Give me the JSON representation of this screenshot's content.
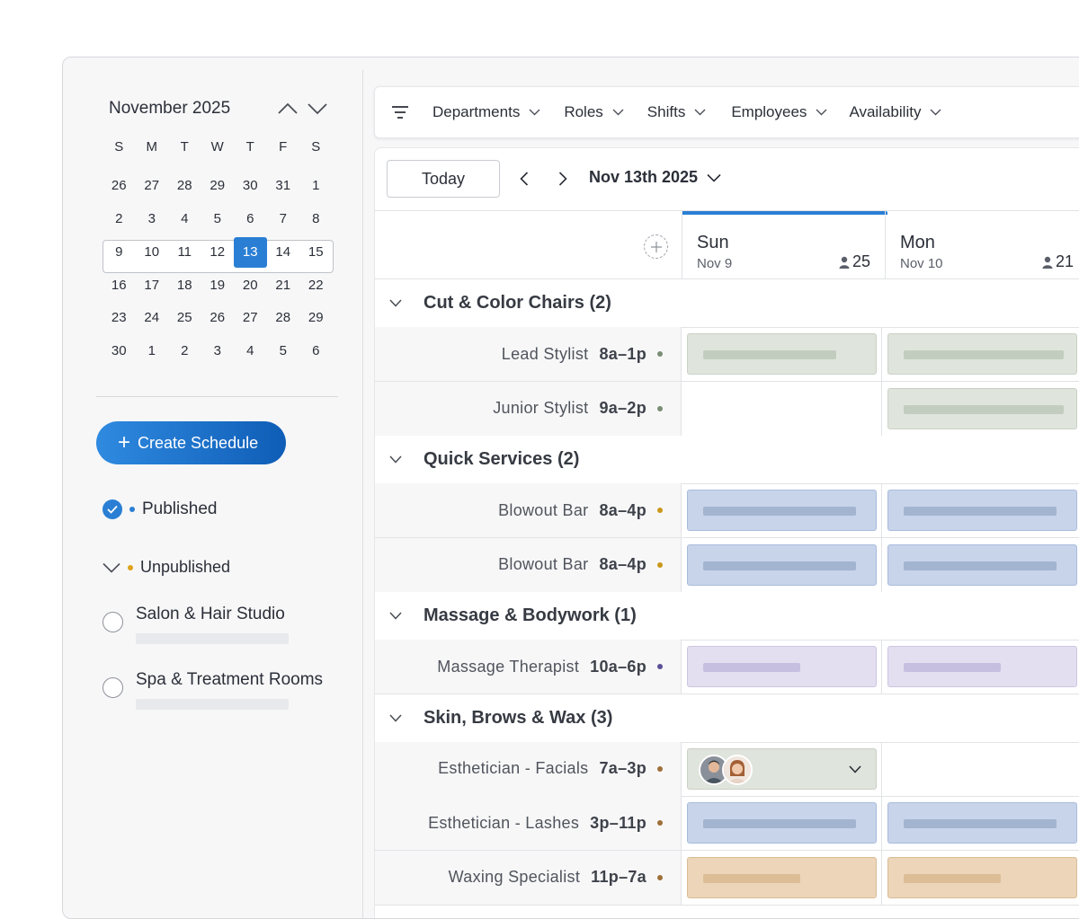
{
  "calendar": {
    "title": "November 2025",
    "weekdays": [
      "S",
      "M",
      "T",
      "W",
      "T",
      "F",
      "S"
    ],
    "weeks": [
      [
        "26",
        "27",
        "28",
        "29",
        "30",
        "31",
        "1"
      ],
      [
        "2",
        "3",
        "4",
        "5",
        "6",
        "7",
        "8"
      ],
      [
        "9",
        "10",
        "11",
        "12",
        "13",
        "14",
        "15"
      ],
      [
        "16",
        "17",
        "18",
        "19",
        "20",
        "21",
        "22"
      ],
      [
        "23",
        "24",
        "25",
        "26",
        "27",
        "28",
        "29"
      ],
      [
        "30",
        "1",
        "2",
        "3",
        "4",
        "5",
        "6"
      ]
    ],
    "selected_day": "13"
  },
  "sidebar": {
    "create_label": "Create Schedule",
    "published_label": "Published",
    "unpublished_label": "Unpublished",
    "locations": [
      {
        "name": "Salon & Hair Studio"
      },
      {
        "name": "Spa & Treatment Rooms"
      }
    ]
  },
  "filters": {
    "items": [
      "Departments",
      "Roles",
      "Shifts",
      "Employees",
      "Availability"
    ]
  },
  "toolbar": {
    "today_label": "Today",
    "current_date": "Nov 13th 2025"
  },
  "days": [
    {
      "name": "Sun",
      "date": "Nov 9",
      "count": "25"
    },
    {
      "name": "Mon",
      "date": "Nov 10",
      "count": "21"
    }
  ],
  "sections": [
    {
      "title": "Cut & Color Chairs (2)",
      "roles": [
        {
          "name": "Lead Stylist",
          "time": "8a–1p",
          "dot": "#7a8f74",
          "color": "green",
          "shifts": [
            true,
            true
          ]
        },
        {
          "name": "Junior Stylist",
          "time": "9a–2p",
          "dot": "#7a8f74",
          "color": "green",
          "shifts": [
            false,
            true
          ]
        }
      ]
    },
    {
      "title": "Quick Services (2)",
      "roles": [
        {
          "name": "Blowout Bar",
          "time": "8a–4p",
          "dot": "#c9981c",
          "color": "blue",
          "shifts": [
            true,
            true
          ]
        },
        {
          "name": "Blowout Bar",
          "time": "8a–4p",
          "dot": "#c9981c",
          "color": "blue",
          "shifts": [
            true,
            true
          ]
        }
      ]
    },
    {
      "title": "Massage & Bodywork (1)",
      "roles": [
        {
          "name": "Massage Therapist",
          "time": "10a–6p",
          "dot": "#5b4f96",
          "color": "purple",
          "shifts": [
            true,
            true
          ]
        }
      ]
    },
    {
      "title": "Skin, Brows & Wax (3)",
      "roles": [
        {
          "name": "Esthetician - Facials",
          "time": "7a–3p",
          "dot": "#a0703a",
          "color": "green",
          "shifts": [
            "avatars",
            false
          ]
        },
        {
          "name": "Esthetician - Lashes",
          "time": "3p–11p",
          "dot": "#a0703a",
          "color": "blue",
          "shifts": [
            true,
            true
          ]
        },
        {
          "name": "Waxing Specialist",
          "time": "11p–7a",
          "dot": "#a0703a",
          "color": "orange",
          "shifts": [
            true,
            true
          ]
        }
      ]
    }
  ],
  "colors": {
    "accent": "#2a7fd4",
    "published_dot": "#2a7fd4",
    "unpublished_dot": "#e0a21a"
  }
}
